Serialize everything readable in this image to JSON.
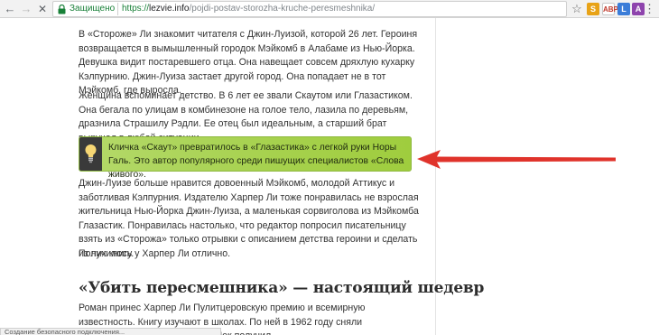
{
  "browser": {
    "back_icon": "←",
    "forward_icon": "→",
    "stop_icon": "✕",
    "secure_label": "Защищено",
    "url_scheme": "https://",
    "url_host": "lezvie.info",
    "url_path": "/pojdi-postav-storozha-kruche-peresmeshnika/",
    "bookmark_icon": "☆",
    "extensions": [
      "S",
      "ABP",
      "L",
      "A"
    ],
    "menu_icon": "⋮"
  },
  "article": {
    "paragraph_1": "В «Стороже» Ли знакомит читателя с Джин-Луизой, которой 26 лет. Героиня возвращается в вымышленный городок Мэйкомб в Алабаме из Нью-Йорка. Девушка видит постаревшего отца. Она навещает совсем дряхлую кухарку Кэлпурнию. Джин-Луиза застает другой город. Она попадает не в тот Мэйкомб, где выросла.",
    "paragraph_2": "Женщина вспоминает детство. В 6 лет ее звали Скаутом или Глазастиком. Она бегала по улицам в комбинезоне на голое тело, лазила по деревьям, дразнила Страшилу Рэдли. Ее отец был идеальным, а старший брат выручал в любой ситуации.",
    "callout": "Кличка «Скаут» превратилось в «Глазастика» с легкой руки Норы Галь. Это автор популярного среди пишущих специалистов «Слова живого».",
    "paragraph_3": "Джин-Луизе больше нравится довоенный Мэйкомб, молодой Аттикус и заботливая Кэлпурния. Издателю Харпер Ли тоже понравилась не взрослая жительница Нью-Йорка Джин-Луиза, а маленькая сорвиголова из Мэйкомба Глазастик. Понравилась настолько, что редактор попросил писательницу взять из «Сторожа» только отрывки с описанием детства героини и сделать из них книгу.",
    "paragraph_4": "Получилось у Харпер Ли отлично.",
    "heading": "«Убить пересмешника» — настоящий шедевр",
    "paragraph_5": "Роман принес Харпер Ли Пулитцеровскую премию и всемирную известность. Книгу изучают в школах. По ней в 1962 году сняли одноименный фильм. Грегори Пек получил"
  },
  "status_bar": "Создание безопасного подключения...",
  "colors": {
    "callout_green": "#a6d14d",
    "arrow_red": "#e0332b",
    "secure_green": "#188038"
  }
}
